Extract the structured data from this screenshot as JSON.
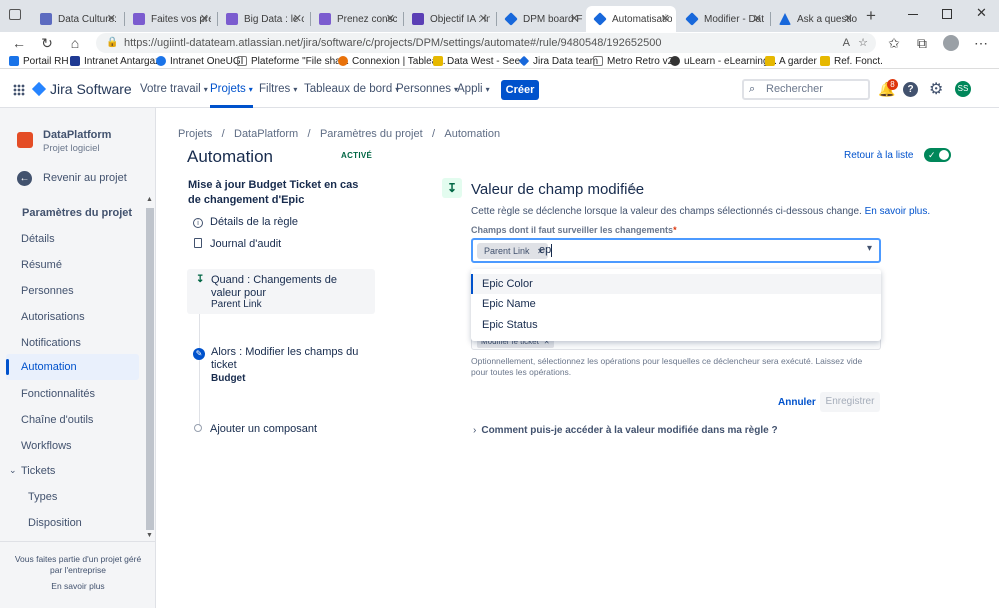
{
  "browser": {
    "tabs": [
      {
        "label": "Data Culture: V",
        "color": "#5c6bc0"
      },
      {
        "label": "Faites vos pre",
        "color": "#7b5ccf"
      },
      {
        "label": "Big Data : le c",
        "color": "#7b5ccf"
      },
      {
        "label": "Prenez conscie",
        "color": "#7b5ccf"
      },
      {
        "label": "Objectif IA : in",
        "color": "#5b3fb5"
      },
      {
        "label": "DPM board FU",
        "color": "#1868db"
      },
      {
        "label": "Automatisatio",
        "color": "#1868db"
      },
      {
        "label": "Modifier - Dat",
        "color": "#1868db"
      },
      {
        "label": "Ask a question",
        "color": "#1868db"
      }
    ],
    "url": "https://ugiintl-datateam.atlassian.net/jira/software/c/projects/DPM/settings/automate#/rule/9480548/192652500",
    "bookmarks": [
      {
        "label": "Portail RH",
        "color": "#1a73e8"
      },
      {
        "label": "Intranet Antargaz",
        "color": "#1f3a93"
      },
      {
        "label": "Intranet OneUGI",
        "color": "#1a73e8"
      },
      {
        "label": "Plateforme \"File sha...",
        "color": "#888888"
      },
      {
        "label": "Connexion | Tablea...",
        "color": "#e8710a"
      },
      {
        "label": "Data West - Seed",
        "color": "#e6b800"
      },
      {
        "label": "Jira Data team",
        "color": "#1868db"
      },
      {
        "label": "Metro Retro v2",
        "color": "#888888"
      },
      {
        "label": "uLearn - eLearning...",
        "color": "#333333"
      },
      {
        "label": "A garder",
        "color": "#e6b800"
      },
      {
        "label": "Ref. Fonct.",
        "color": "#e6b800"
      }
    ]
  },
  "header": {
    "app_name": "Jira Software",
    "nav": [
      "Votre travail",
      "Projets",
      "Filtres",
      "Tableaux de bord",
      "Personnes",
      "Appli"
    ],
    "create_label": "Créer",
    "search_placeholder": "Rechercher",
    "notif_count": "8",
    "avatar_initials": "SS"
  },
  "sidebar": {
    "project_name": "DataPlatform",
    "project_type": "Projet logiciel",
    "back_label": "Revenir au projet",
    "section_title": "Paramètres du projet",
    "items": [
      "Détails",
      "Résumé",
      "Personnes",
      "Autorisations",
      "Notifications",
      "Automation",
      "Fonctionnalités",
      "Chaîne d'outils",
      "Workflows",
      "Tickets",
      "Types",
      "Disposition"
    ],
    "footer_text": "Vous faites partie d'un projet géré par l'entreprise",
    "footer_link": "En savoir plus"
  },
  "breadcrumb": [
    "Projets",
    "DataPlatform",
    "Paramètres du projet",
    "Automation"
  ],
  "page": {
    "title": "Automation",
    "status_badge": "ACTIVÉ",
    "back_to_list": "Retour à la liste"
  },
  "rule": {
    "name": "Mise à jour Budget Ticket en cas de changement d'Epic",
    "details_label": "Détails de la règle",
    "audit_label": "Journal d'audit",
    "trigger_title": "Quand : Changements de valeur pour",
    "trigger_value": "Parent Link",
    "action_title": "Alors : Modifier les champs du ticket",
    "action_value": "Budget",
    "add_component": "Ajouter un composant"
  },
  "panel": {
    "title": "Valeur de champ modifiée",
    "description": "Cette règle se déclenche lorsque la valeur des champs sélectionnés ci-dessous change.",
    "learn_more": "En savoir plus.",
    "field_label": "Champs dont il faut surveiller les changements",
    "required_mark": "*",
    "chip_label": "Parent Link",
    "input_value": "ep",
    "options": [
      "Epic Color",
      "Epic Name",
      "Epic Status"
    ],
    "ops_chip": "Modifier le ticket",
    "ops_help": "Optionnellement, sélectionnez les opérations pour lesquelles ce déclencheur sera exécuté. Laissez vide pour toutes les opérations.",
    "cancel_label": "Annuler",
    "save_label": "Enregistrer",
    "faq_label": "Comment puis-je accéder à la valeur modifiée dans ma règle ?"
  }
}
